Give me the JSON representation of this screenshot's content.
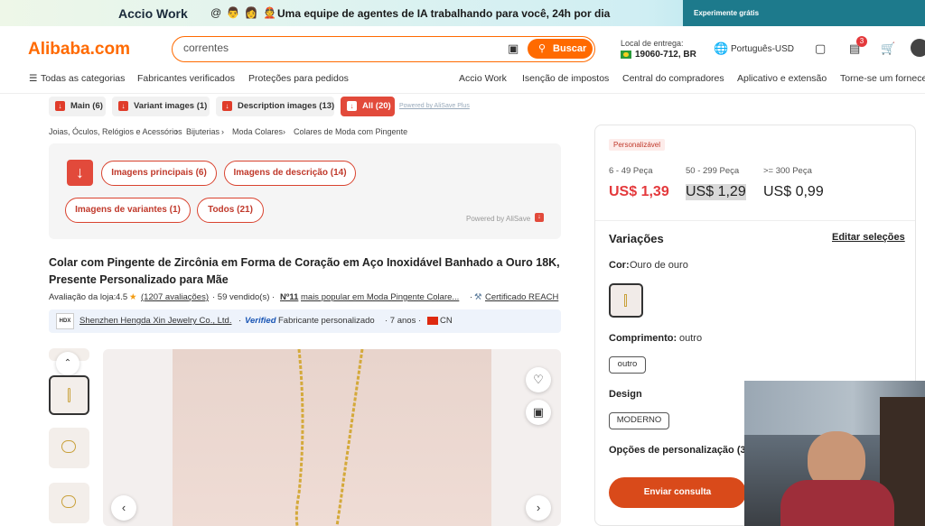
{
  "banner": {
    "brand": "Accio Work",
    "avatars": "@ 👨 👩 👲",
    "message": "Uma equipe de agentes de IA trabalhando para você, 24h por dia",
    "cta": "Experimente grátis"
  },
  "header": {
    "logo": "Alibaba.com",
    "search_value": "correntes",
    "search_button": "Buscar",
    "delivery_label": "Local de entrega:",
    "delivery_value": "19060-712, BR",
    "language": "Português-USD",
    "notification_count": "3"
  },
  "nav": {
    "all_categories": "Todas as categorias",
    "items": [
      "Fabricantes verificados",
      "Proteções para pedidos"
    ],
    "right_items": [
      "Accio Work",
      "Isenção de impostos",
      "Central do compradores",
      "Aplicativo e extensão",
      "Torne-se um fornece"
    ]
  },
  "chips": [
    "Main (6)",
    "Variant images (1)",
    "Description images (13)",
    "All (20)"
  ],
  "chips_powered": "Powered by AliSave Plus",
  "breadcrumb": [
    "Joias, Óculos, Relógios e Acessórios",
    "Bijuterias",
    "Moda Colares",
    "Colares de Moda com Pingente"
  ],
  "alisave": {
    "buttons": [
      "Imagens principais (6)",
      "Imagens de descrição (14)",
      "Imagens de variantes (1)",
      "Todos (21)"
    ],
    "powered": "Powered by AliSave"
  },
  "product": {
    "title": "Colar com Pingente de Zircônia em Forma de Coração em Aço Inoxidável Banhado a Ouro 18K, Presente Personalizado para Mãe",
    "rating_label": "Avaliação da loja:",
    "rating": "4.5",
    "reviews": "(1207 avaliações)",
    "sold": "· 59 vendido(s) ·",
    "rank_bold": "Nº11",
    "rank_text": "mais popular em Moda Pingente Colare...",
    "cert": "Certificado REACH"
  },
  "supplier": {
    "badge": "HDX",
    "name": "Shenzhen Hengda Xin Jewelry Co., Ltd.",
    "verified": "Verified",
    "type": "Fabricante personalizado",
    "years": "· 7 anos ·",
    "country": "CN"
  },
  "pricing": {
    "badge": "Personalizável",
    "tiers": [
      {
        "range": "6 - 49 Peça",
        "price": "US$ 1,39"
      },
      {
        "range": "50 - 299 Peça",
        "price": "US$ 1,29"
      },
      {
        "range": ">= 300 Peça",
        "price": "US$ 0,99"
      }
    ],
    "accent": "#e4393c"
  },
  "variations": {
    "heading": "Variações",
    "edit": "Editar seleções",
    "color_label": "Cor:",
    "color_value": "Ouro de ouro",
    "length_label": "Comprimento:",
    "length_value": "outro",
    "length_option": "outro",
    "design_label": "Design",
    "design_option": "MODERNO",
    "custom_label": "Opções de personalização (3"
  },
  "actions": {
    "inquiry": "Enviar consulta"
  }
}
